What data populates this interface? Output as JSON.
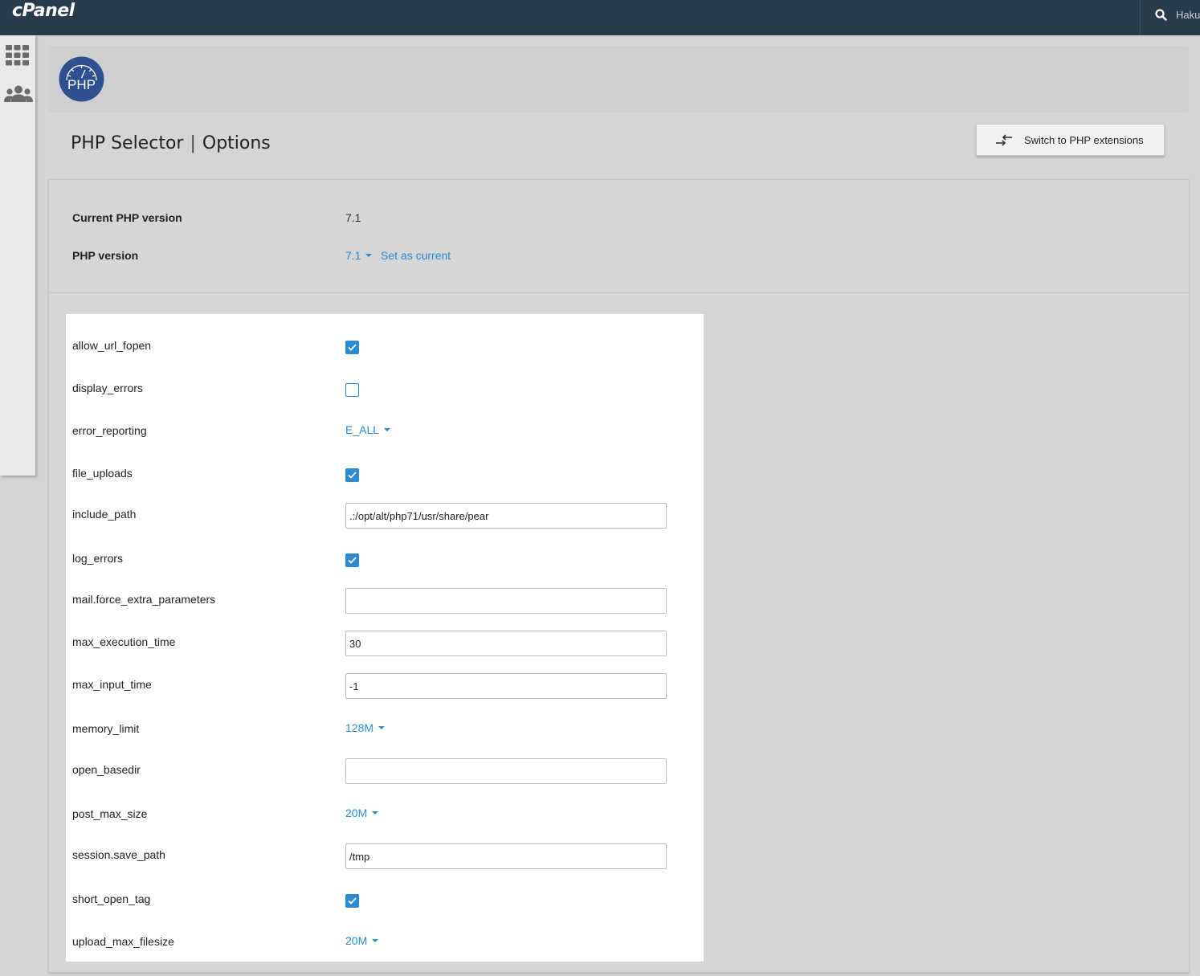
{
  "topbar": {
    "logo": "cPanel",
    "search_text": "Haku",
    "search_icon": "search-icon"
  },
  "sidebar": {
    "items": [
      {
        "icon": "grid-icon"
      },
      {
        "icon": "users-icon"
      }
    ]
  },
  "header": {
    "logo_text": "PHP",
    "logo_color": "#2e5091"
  },
  "page": {
    "title": "PHP Selector",
    "separator": "|",
    "subtitle": "Options",
    "switch_button": "Switch to PHP extensions"
  },
  "version": {
    "current_label": "Current PHP version",
    "current_value": "7.1",
    "select_label": "PHP version",
    "select_value": "7.1",
    "set_current_link": "Set as current"
  },
  "options": [
    {
      "name": "allow_url_fopen",
      "type": "checkbox",
      "checked": true
    },
    {
      "name": "display_errors",
      "type": "checkbox",
      "checked": false
    },
    {
      "name": "error_reporting",
      "type": "dropdown",
      "value": "E_ALL"
    },
    {
      "name": "file_uploads",
      "type": "checkbox",
      "checked": true
    },
    {
      "name": "include_path",
      "type": "text",
      "value": ".:/opt/alt/php71/usr/share/pear"
    },
    {
      "name": "log_errors",
      "type": "checkbox",
      "checked": true
    },
    {
      "name": "mail.force_extra_parameters",
      "type": "text",
      "value": ""
    },
    {
      "name": "max_execution_time",
      "type": "text",
      "value": "30"
    },
    {
      "name": "max_input_time",
      "type": "text",
      "value": "-1"
    },
    {
      "name": "memory_limit",
      "type": "dropdown",
      "value": "128M"
    },
    {
      "name": "open_basedir",
      "type": "text",
      "value": ""
    },
    {
      "name": "post_max_size",
      "type": "dropdown",
      "value": "20M"
    },
    {
      "name": "session.save_path",
      "type": "text",
      "value": "/tmp"
    },
    {
      "name": "short_open_tag",
      "type": "checkbox",
      "checked": true
    },
    {
      "name": "upload_max_filesize",
      "type": "dropdown",
      "value": "20M"
    }
  ],
  "colors": {
    "topbar": "#293a4a",
    "accent": "#2a8ad4",
    "background": "#d5d5d5"
  }
}
